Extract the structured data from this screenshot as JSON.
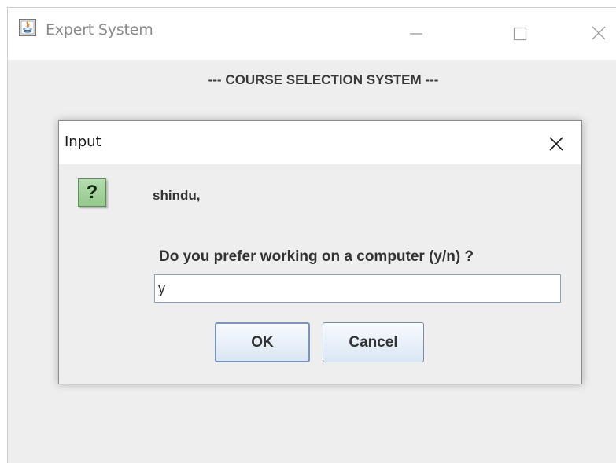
{
  "window": {
    "title": "Expert System",
    "app_icon": "java-icon"
  },
  "controls": {
    "minimize_icon": "minimize-icon",
    "maximize_icon": "maximize-icon",
    "close_icon": "close-icon"
  },
  "main": {
    "header": "--- COURSE SELECTION SYSTEM ---"
  },
  "dialog": {
    "title": "Input",
    "close_icon": "close-icon",
    "icon": "question-icon",
    "icon_glyph": "?",
    "name_line": "shindu,",
    "prompt": "Do you prefer working on a computer (y/n) ?",
    "input_value": "y",
    "ok_label": "OK",
    "cancel_label": "Cancel"
  },
  "colors": {
    "dialog_background": "#eeeeee",
    "question_icon": "#9ccf95",
    "button_border": "#7a8ea6"
  }
}
